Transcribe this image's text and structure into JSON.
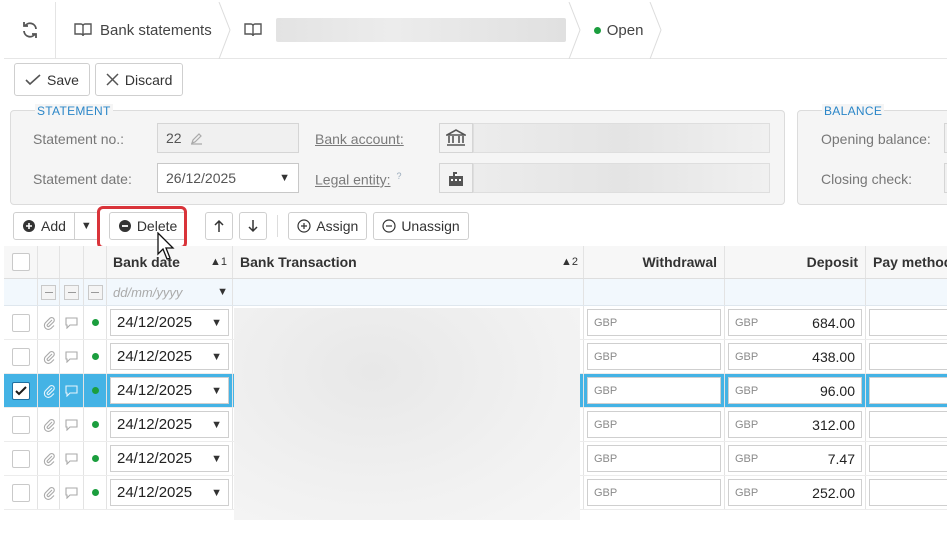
{
  "breadcrumb": {
    "root_label": "Bank statements",
    "status_label": "Open"
  },
  "toolbar": {
    "save_label": "Save",
    "discard_label": "Discard"
  },
  "statement": {
    "section_label": "STATEMENT",
    "statement_no_label": "Statement no.:",
    "statement_no_value": "22",
    "statement_date_label": "Statement date:",
    "statement_date_value": "26/12/2025",
    "bank_account_label": "Bank account:",
    "legal_entity_label": "Legal entity:",
    "help_mark": "?"
  },
  "balance": {
    "section_label": "BALANCE",
    "opening_label": "Opening balance:",
    "closing_label": "Closing check:"
  },
  "grid_toolbar": {
    "add_label": "Add",
    "delete_label": "Delete",
    "assign_label": "Assign",
    "unassign_label": "Unassign"
  },
  "grid": {
    "headers": {
      "bank_date": "Bank date",
      "bank_date_sort": "1",
      "bank_transaction": "Bank Transaction",
      "bank_transaction_sort": "2",
      "withdrawal": "Withdrawal",
      "deposit": "Deposit",
      "pay_method": "Pay method"
    },
    "filter_date_placeholder": "dd/mm/yyyy",
    "currency": "GBP",
    "rows": [
      {
        "date": "24/12/2025",
        "deposit": "684.00",
        "selected": false
      },
      {
        "date": "24/12/2025",
        "deposit": "438.00",
        "selected": false
      },
      {
        "date": "24/12/2025",
        "deposit": "96.00",
        "selected": true
      },
      {
        "date": "24/12/2025",
        "deposit": "312.00",
        "selected": false
      },
      {
        "date": "24/12/2025",
        "deposit": "7.47",
        "selected": false
      },
      {
        "date": "24/12/2025",
        "deposit": "252.00",
        "selected": false
      }
    ]
  },
  "colors": {
    "accent": "#2a86c8",
    "selected_row": "#44b3e5",
    "status_dot": "#1b9e3e",
    "highlight": "#d9343a"
  }
}
